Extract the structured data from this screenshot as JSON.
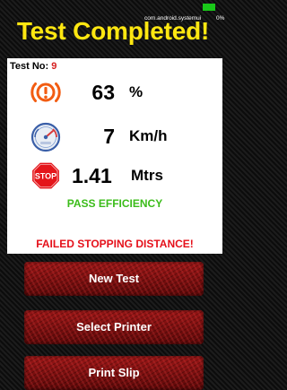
{
  "status_bar": {
    "app_id": "com.android.systemui",
    "battery_text": "0%"
  },
  "header": {
    "title": "Test Completed!",
    "title_color": "#ffe711"
  },
  "result": {
    "test_no_label": "Test No:",
    "test_no_value": "9",
    "metrics": [
      {
        "icon": "brake-warning-icon",
        "value": "63",
        "unit": "%"
      },
      {
        "icon": "speedometer-icon",
        "value": "7",
        "unit": "Km/h"
      },
      {
        "icon": "stop-sign-icon",
        "value": "1.41",
        "unit": "Mtrs"
      }
    ],
    "efficiency_status": "PASS EFFICIENCY",
    "efficiency_color": "#3bbc1a",
    "distance_status": "FAILED STOPPING DISTANCE!",
    "distance_color": "#e5101a"
  },
  "actions": {
    "new_test_label": "New Test",
    "select_printer_label": "Select Printer",
    "print_slip_label": "Print Slip"
  }
}
